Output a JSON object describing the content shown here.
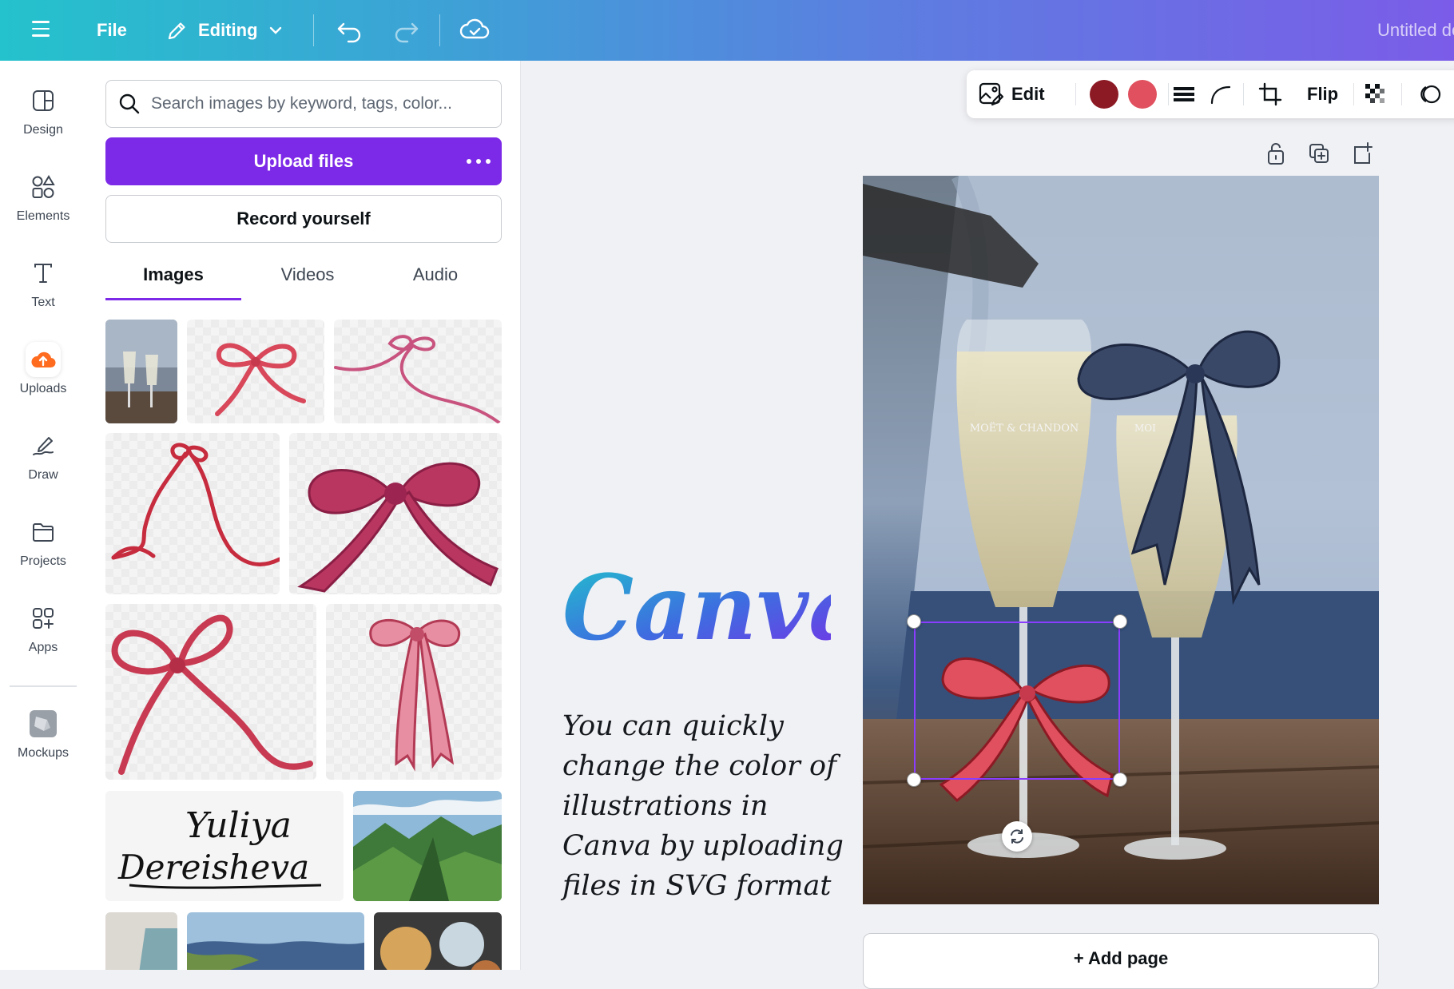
{
  "topbar": {
    "file_label": "File",
    "mode_label": "Editing",
    "doc_title": "Untitled design"
  },
  "rail": {
    "items": [
      {
        "label": "Design",
        "icon": "design-icon"
      },
      {
        "label": "Elements",
        "icon": "elements-icon"
      },
      {
        "label": "Text",
        "icon": "text-icon"
      },
      {
        "label": "Uploads",
        "icon": "uploads-icon"
      },
      {
        "label": "Draw",
        "icon": "draw-icon"
      },
      {
        "label": "Projects",
        "icon": "projects-icon"
      },
      {
        "label": "Apps",
        "icon": "apps-icon"
      },
      {
        "label": "Mockups",
        "icon": "mockups-icon"
      }
    ],
    "active_index": 3
  },
  "panel": {
    "search_placeholder": "Search images by keyword, tags, color...",
    "upload_label": "Upload files",
    "record_label": "Record yourself",
    "tabs": [
      "Images",
      "Videos",
      "Audio"
    ],
    "active_tab": "Images",
    "signature_line1": "Yuliya",
    "signature_line2": "Dereisheva"
  },
  "context_toolbar": {
    "edit_label": "Edit",
    "flip_label": "Flip",
    "swatches": [
      "#8c1a24",
      "#e0505e"
    ]
  },
  "canvas": {
    "logo_text": "Canva",
    "tagline_lines": [
      "You can quickly",
      "change the color of",
      "illustrations in",
      "Canva by uploading",
      "files in SVG format"
    ],
    "glass_engraving_left": "MOËT & CHANDON",
    "glass_engraving_right": "MOI",
    "add_page_label": "+ Add page"
  },
  "colors": {
    "brand_purple": "#7d2ae8",
    "selection": "#8b3dff",
    "bow_red": "#e0505e",
    "bow_navy": "#3a4868"
  }
}
